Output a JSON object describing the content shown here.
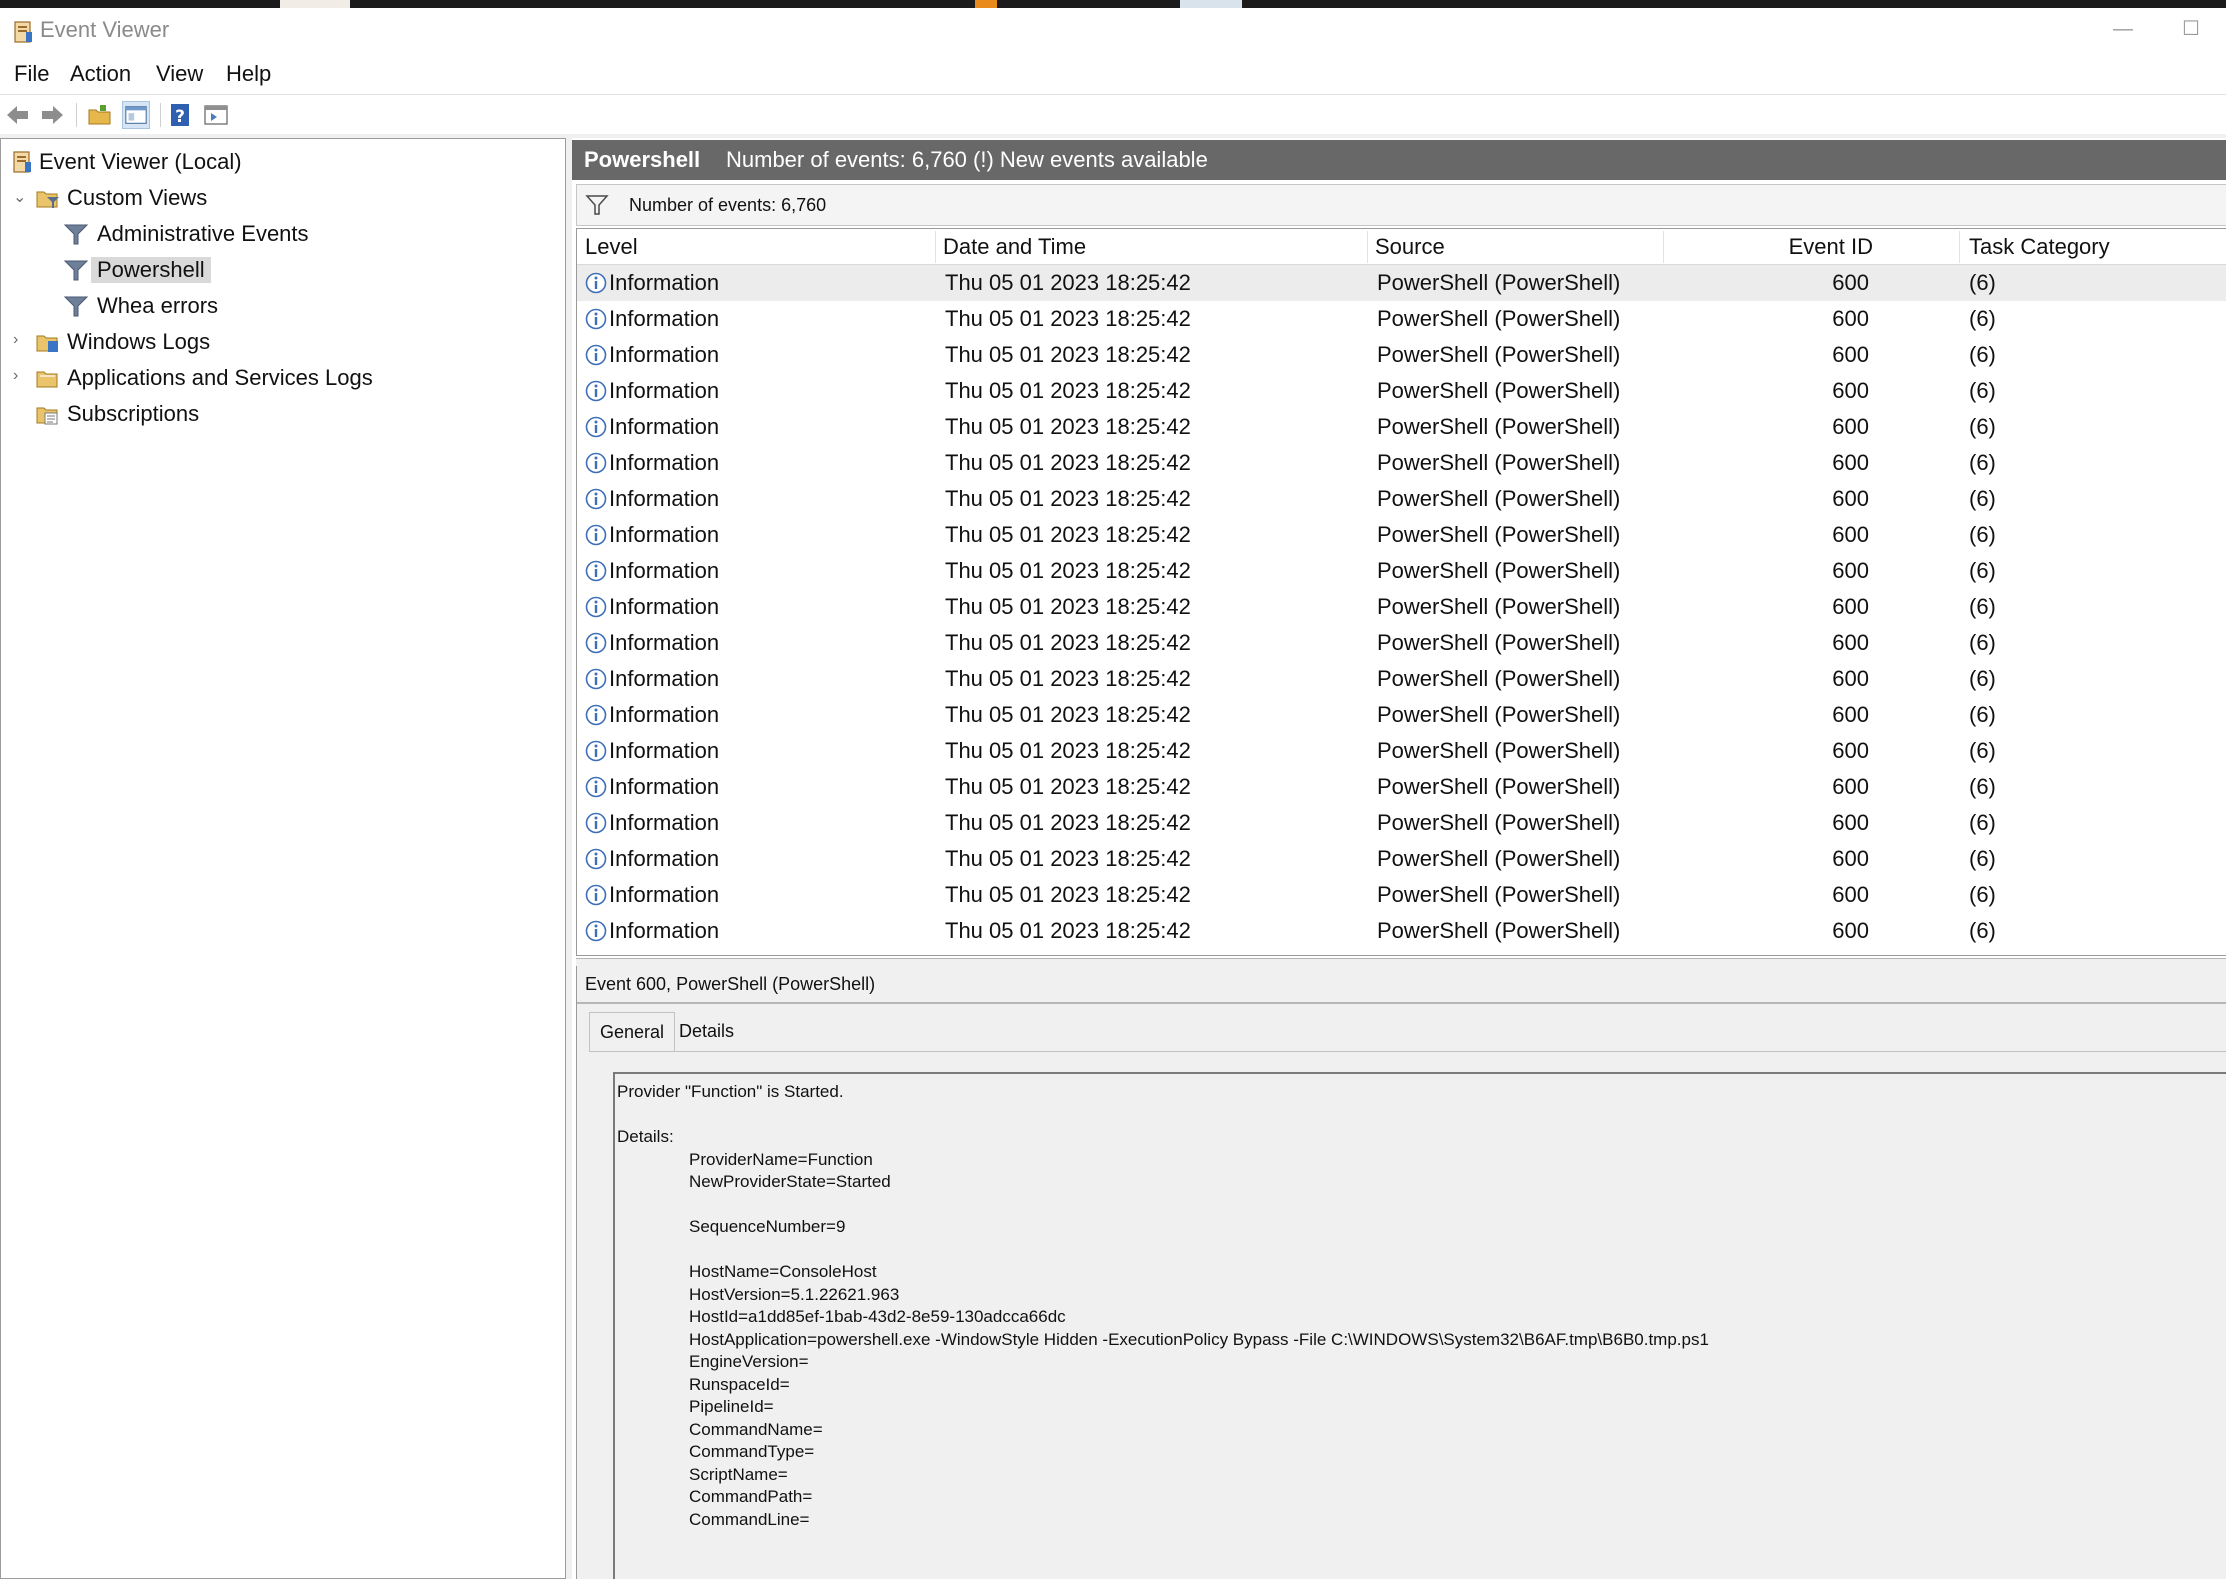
{
  "window": {
    "title": "Event Viewer",
    "minimize_glyph": "—",
    "maximize_glyph": "☐"
  },
  "menu": [
    "File",
    "Action",
    "View",
    "Help"
  ],
  "toolbar": {
    "icons": [
      "back-arrow-icon",
      "forward-arrow-icon",
      "open-folder-icon",
      "console-tree-icon",
      "help-icon",
      "action-pane-icon"
    ]
  },
  "nav": {
    "root": "Event Viewer (Local)",
    "custom_views": "Custom Views",
    "administrative_events": "Administrative Events",
    "powershell": "Powershell",
    "whea_errors": "Whea errors",
    "windows_logs": "Windows Logs",
    "app_services_logs": "Applications and Services Logs",
    "subscriptions": "Subscriptions"
  },
  "header": {
    "name": "Powershell",
    "summary": "Number of events: 6,760 (!) New events available"
  },
  "filter": {
    "text": "Number of events: 6,760"
  },
  "columns": {
    "level": "Level",
    "datetime": "Date and Time",
    "source": "Source",
    "eventid": "Event ID",
    "category": "Task Category"
  },
  "events": [
    {
      "level": "Information",
      "datetime": "Thu 05 01 2023 18:25:42",
      "source": "PowerShell (PowerShell)",
      "eventid": "600",
      "category": "(6)"
    },
    {
      "level": "Information",
      "datetime": "Thu 05 01 2023 18:25:42",
      "source": "PowerShell (PowerShell)",
      "eventid": "600",
      "category": "(6)"
    },
    {
      "level": "Information",
      "datetime": "Thu 05 01 2023 18:25:42",
      "source": "PowerShell (PowerShell)",
      "eventid": "600",
      "category": "(6)"
    },
    {
      "level": "Information",
      "datetime": "Thu 05 01 2023 18:25:42",
      "source": "PowerShell (PowerShell)",
      "eventid": "600",
      "category": "(6)"
    },
    {
      "level": "Information",
      "datetime": "Thu 05 01 2023 18:25:42",
      "source": "PowerShell (PowerShell)",
      "eventid": "600",
      "category": "(6)"
    },
    {
      "level": "Information",
      "datetime": "Thu 05 01 2023 18:25:42",
      "source": "PowerShell (PowerShell)",
      "eventid": "600",
      "category": "(6)"
    },
    {
      "level": "Information",
      "datetime": "Thu 05 01 2023 18:25:42",
      "source": "PowerShell (PowerShell)",
      "eventid": "600",
      "category": "(6)"
    },
    {
      "level": "Information",
      "datetime": "Thu 05 01 2023 18:25:42",
      "source": "PowerShell (PowerShell)",
      "eventid": "600",
      "category": "(6)"
    },
    {
      "level": "Information",
      "datetime": "Thu 05 01 2023 18:25:42",
      "source": "PowerShell (PowerShell)",
      "eventid": "600",
      "category": "(6)"
    },
    {
      "level": "Information",
      "datetime": "Thu 05 01 2023 18:25:42",
      "source": "PowerShell (PowerShell)",
      "eventid": "600",
      "category": "(6)"
    },
    {
      "level": "Information",
      "datetime": "Thu 05 01 2023 18:25:42",
      "source": "PowerShell (PowerShell)",
      "eventid": "600",
      "category": "(6)"
    },
    {
      "level": "Information",
      "datetime": "Thu 05 01 2023 18:25:42",
      "source": "PowerShell (PowerShell)",
      "eventid": "600",
      "category": "(6)"
    },
    {
      "level": "Information",
      "datetime": "Thu 05 01 2023 18:25:42",
      "source": "PowerShell (PowerShell)",
      "eventid": "600",
      "category": "(6)"
    },
    {
      "level": "Information",
      "datetime": "Thu 05 01 2023 18:25:42",
      "source": "PowerShell (PowerShell)",
      "eventid": "600",
      "category": "(6)"
    },
    {
      "level": "Information",
      "datetime": "Thu 05 01 2023 18:25:42",
      "source": "PowerShell (PowerShell)",
      "eventid": "600",
      "category": "(6)"
    },
    {
      "level": "Information",
      "datetime": "Thu 05 01 2023 18:25:42",
      "source": "PowerShell (PowerShell)",
      "eventid": "600",
      "category": "(6)"
    },
    {
      "level": "Information",
      "datetime": "Thu 05 01 2023 18:25:42",
      "source": "PowerShell (PowerShell)",
      "eventid": "600",
      "category": "(6)"
    },
    {
      "level": "Information",
      "datetime": "Thu 05 01 2023 18:25:42",
      "source": "PowerShell (PowerShell)",
      "eventid": "600",
      "category": "(6)"
    },
    {
      "level": "Information",
      "datetime": "Thu 05 01 2023 18:25:42",
      "source": "PowerShell (PowerShell)",
      "eventid": "600",
      "category": "(6)"
    }
  ],
  "detail": {
    "title": "Event 600, PowerShell (PowerShell)",
    "tab_general": "General",
    "tab_details": "Details",
    "message_lines": [
      "Provider \"Function\" is Started.",
      "",
      "Details:",
      "\tProviderName=Function",
      "\tNewProviderState=Started",
      "",
      "\tSequenceNumber=9",
      "",
      "\tHostName=ConsoleHost",
      "\tHostVersion=5.1.22621.963",
      "\tHostId=a1dd85ef-1bab-43d2-8e59-130adcca66dc",
      "\tHostApplication=powershell.exe -WindowStyle Hidden -ExecutionPolicy Bypass -File C:\\WINDOWS\\System32\\B6AF.tmp\\B6B0.tmp.ps1",
      "\tEngineVersion=",
      "\tRunspaceId=",
      "\tPipelineId=",
      "\tCommandName=",
      "\tCommandType=",
      "\tScriptName=",
      "\tCommandPath=",
      "\tCommandLine="
    ]
  }
}
